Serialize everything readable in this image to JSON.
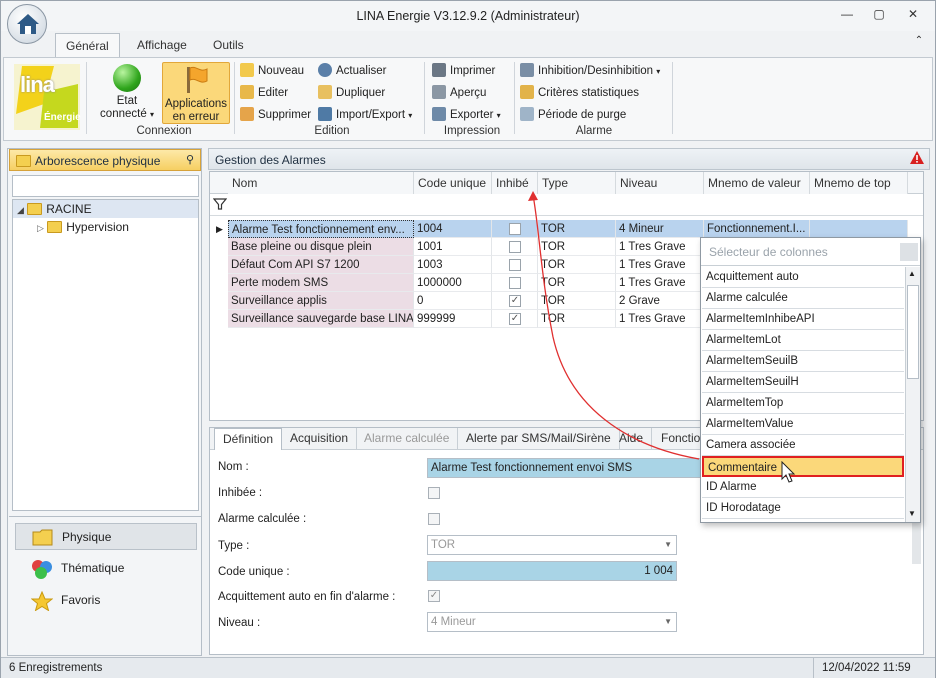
{
  "window": {
    "title": "LINA Energie  V3.12.9.2  (Administrateur)"
  },
  "menu_tabs": [
    "Général",
    "Affichage",
    "Outils"
  ],
  "ribbon": {
    "logo_text": "lina",
    "logo_sub": "Énergie",
    "etat_label1": "Etat",
    "etat_label2": "connecté",
    "apps_label1": "Applications",
    "apps_label2": "en erreur",
    "group_connexion": "Connexion",
    "nouveau": "Nouveau",
    "editer": "Editer",
    "supprimer": "Supprimer",
    "actualiser": "Actualiser",
    "dupliquer": "Dupliquer",
    "import_export": "Import/Export",
    "group_edition": "Edition",
    "imprimer": "Imprimer",
    "apercu": "Aperçu",
    "exporter": "Exporter",
    "group_impression": "Impression",
    "inhibition": "Inhibition/Desinhibition",
    "criteres": "Critères statistiques",
    "periode": "Période de purge",
    "group_alarme": "Alarme"
  },
  "left": {
    "title": "Arborescence physique",
    "tree_root": "RACINE",
    "tree_child": "Hypervision",
    "nav": [
      "Physique",
      "Thématique",
      "Favoris"
    ]
  },
  "grid": {
    "title": "Gestion des Alarmes",
    "columns": [
      "Nom",
      "Code unique",
      "Inhibé",
      "Type",
      "Niveau",
      "Mnemo de valeur",
      "Mnemo de top"
    ],
    "rows": [
      {
        "nom": "Alarme Test fonctionnement env...",
        "code": "1004",
        "inhibe": false,
        "type": "TOR",
        "niveau": "4 Mineur",
        "mnemo": "Fonctionnement.I..."
      },
      {
        "nom": "Base pleine ou disque plein",
        "code": "1001",
        "inhibe": false,
        "type": "TOR",
        "niveau": "1 Tres Grave",
        "mnemo": ""
      },
      {
        "nom": "Défaut Com API S7 1200",
        "code": "1003",
        "inhibe": false,
        "type": "TOR",
        "niveau": "1 Tres Grave",
        "mnemo": ""
      },
      {
        "nom": "Perte modem SMS",
        "code": "1000000",
        "inhibe": false,
        "type": "TOR",
        "niveau": "1 Tres Grave",
        "mnemo": ""
      },
      {
        "nom": "Surveillance applis",
        "code": "0",
        "inhibe": true,
        "type": "TOR",
        "niveau": "2 Grave",
        "mnemo": ""
      },
      {
        "nom": "Surveillance sauvegarde base LINA",
        "code": "999999",
        "inhibe": true,
        "type": "TOR",
        "niveau": "1 Tres Grave",
        "mnemo": ""
      }
    ]
  },
  "detail": {
    "tabs": [
      "Définition",
      "Acquisition",
      "Alarme calculée",
      "Alerte par SMS/Mail/Sirène",
      "Aide",
      "Fonctio"
    ],
    "nom_label": "Nom :",
    "nom_value": "Alarme Test fonctionnement envoi SMS",
    "inhibee_label": "Inhibée :",
    "alarme_calc_label": "Alarme calculée :",
    "type_label": "Type :",
    "type_value": "TOR",
    "code_label": "Code unique :",
    "code_value": "1 004",
    "acquit_label": "Acquittement auto en fin d'alarme :",
    "niveau_label": "Niveau :",
    "niveau_value": "4 Mineur"
  },
  "column_chooser": {
    "title": "Sélecteur de colonnes",
    "items": [
      "Acquittement auto",
      "Alarme calculée",
      "AlarmeItemInhibeAPI",
      "AlarmeItemLot",
      "AlarmeItemSeuilB",
      "AlarmeItemSeuilH",
      "AlarmeItemTop",
      "AlarmeItemValue",
      "Camera associée",
      "Commentaire",
      "ID Alarme",
      "ID Horodatage"
    ],
    "highlighted": "Commentaire"
  },
  "status": {
    "records": "6 Enregistrements",
    "datetime": "12/04/2022 11:59"
  },
  "colors": {
    "accent_orange": "#fbd87a",
    "highlight_red": "#e02020",
    "selected_row": "#b9d3ee"
  }
}
